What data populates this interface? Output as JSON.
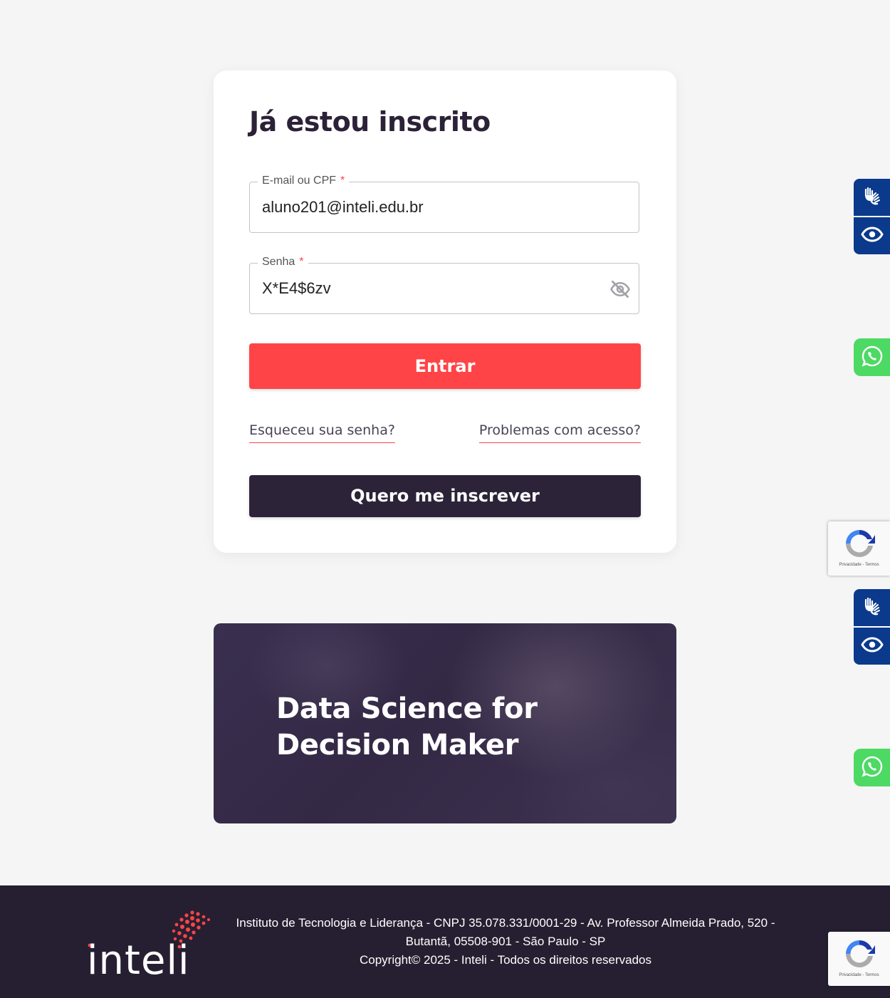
{
  "login": {
    "title": "Já estou inscrito",
    "email_label": "E-mail ou CPF",
    "email_value": "aluno201@inteli.edu.br",
    "required_mark": "*",
    "password_label": "Senha",
    "password_value": "X*E4$6zv",
    "submit_label": "Entrar",
    "forgot_password": "Esqueceu sua senha?",
    "access_problems": "Problemas com acesso?",
    "signup_label": "Quero me inscrever"
  },
  "banner": {
    "title": "Data Science for Decision Maker"
  },
  "recaptcha": {
    "terms": "Privacidade - Termos"
  },
  "footer": {
    "logo_text": "inteli",
    "address_line1": "Instituto de Tecnologia e Liderança - CNPJ 35.078.331/0001-29 - Av. Professor Almeida Prado, 520 -",
    "address_line2": "Butantã, 05508-901 - São Paulo - SP",
    "copyright": "Copyright© 2025 - Inteli - Todos os direitos reservados"
  },
  "colors": {
    "accent_red": "#ff4447",
    "dark_purple": "#2c2339",
    "footer_bg": "#261f31",
    "a11y_blue": "#0b3a8c",
    "whatsapp_green": "#4cd964"
  },
  "icons": [
    "eye-off-icon",
    "sign-language-icon",
    "eye-icon",
    "whatsapp-icon",
    "recaptcha-icon"
  ]
}
